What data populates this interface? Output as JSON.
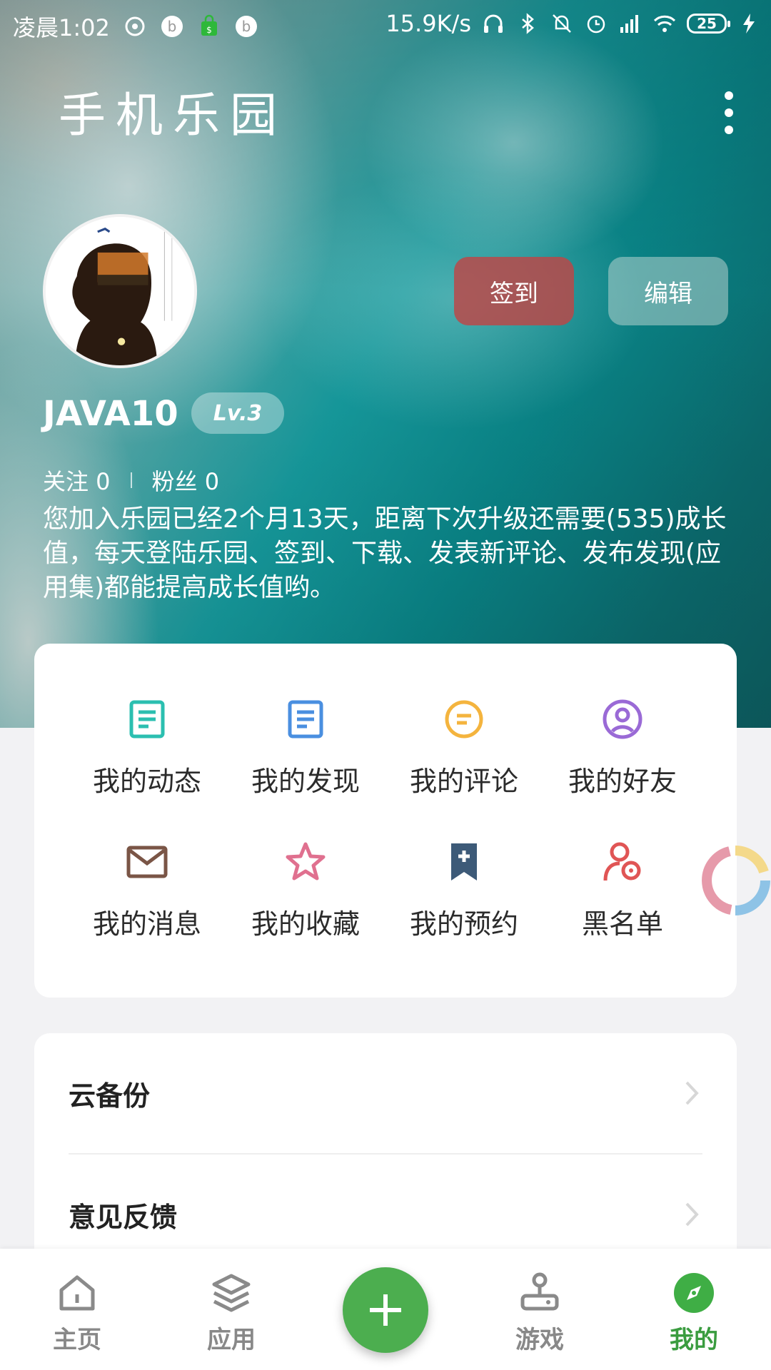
{
  "status_bar": {
    "time": "凌晨1:02",
    "net_speed": "15.9K/s",
    "battery": "25"
  },
  "header": {
    "title": "手机乐园"
  },
  "profile": {
    "checkin_label": "签到",
    "edit_label": "编辑",
    "username": "JAVA10",
    "level": "Lv.3",
    "following": "关注 0",
    "followers": "粉丝 0",
    "description": "您加入乐园已经2个月13天，距离下次升级还需要(535)成长值，每天登陆乐园、签到、下载、发表新评论、发布发现(应用集)都能提高成长值哟。"
  },
  "grid": {
    "items": [
      {
        "label": "我的动态",
        "icon": "document-icon",
        "color": "#2bbfb0"
      },
      {
        "label": "我的发现",
        "icon": "discover-icon",
        "color": "#4a8fe0"
      },
      {
        "label": "我的评论",
        "icon": "comment-icon",
        "color": "#f4b43e"
      },
      {
        "label": "我的好友",
        "icon": "friend-icon",
        "color": "#9a6ad6"
      },
      {
        "label": "我的消息",
        "icon": "mail-icon",
        "color": "#7a5546"
      },
      {
        "label": "我的收藏",
        "icon": "star-icon",
        "color": "#e0708f"
      },
      {
        "label": "我的预约",
        "icon": "bookmark-icon",
        "color": "#3d5a78"
      },
      {
        "label": "黑名单",
        "icon": "blacklist-icon",
        "color": "#e05555"
      }
    ]
  },
  "list": {
    "items": [
      {
        "label": "云备份"
      },
      {
        "label": "意见反馈"
      }
    ]
  },
  "bottom_nav": {
    "items": [
      {
        "label": "主页",
        "icon": "home-icon"
      },
      {
        "label": "应用",
        "icon": "layers-icon"
      },
      {
        "label": "游戏",
        "icon": "joystick-icon"
      },
      {
        "label": "我的",
        "icon": "compass-icon",
        "active": true
      }
    ],
    "accent_color": "#4cae4f"
  }
}
